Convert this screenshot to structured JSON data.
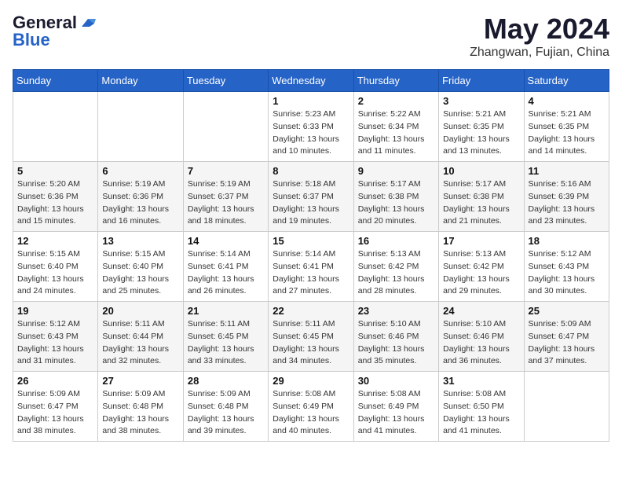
{
  "logo": {
    "general": "General",
    "blue": "Blue",
    "tagline": ""
  },
  "header": {
    "title": "May 2024",
    "location": "Zhangwan, Fujian, China"
  },
  "weekdays": [
    "Sunday",
    "Monday",
    "Tuesday",
    "Wednesday",
    "Thursday",
    "Friday",
    "Saturday"
  ],
  "weeks": [
    [
      {
        "day": "",
        "info": ""
      },
      {
        "day": "",
        "info": ""
      },
      {
        "day": "",
        "info": ""
      },
      {
        "day": "1",
        "info": "Sunrise: 5:23 AM\nSunset: 6:33 PM\nDaylight: 13 hours\nand 10 minutes."
      },
      {
        "day": "2",
        "info": "Sunrise: 5:22 AM\nSunset: 6:34 PM\nDaylight: 13 hours\nand 11 minutes."
      },
      {
        "day": "3",
        "info": "Sunrise: 5:21 AM\nSunset: 6:35 PM\nDaylight: 13 hours\nand 13 minutes."
      },
      {
        "day": "4",
        "info": "Sunrise: 5:21 AM\nSunset: 6:35 PM\nDaylight: 13 hours\nand 14 minutes."
      }
    ],
    [
      {
        "day": "5",
        "info": "Sunrise: 5:20 AM\nSunset: 6:36 PM\nDaylight: 13 hours\nand 15 minutes."
      },
      {
        "day": "6",
        "info": "Sunrise: 5:19 AM\nSunset: 6:36 PM\nDaylight: 13 hours\nand 16 minutes."
      },
      {
        "day": "7",
        "info": "Sunrise: 5:19 AM\nSunset: 6:37 PM\nDaylight: 13 hours\nand 18 minutes."
      },
      {
        "day": "8",
        "info": "Sunrise: 5:18 AM\nSunset: 6:37 PM\nDaylight: 13 hours\nand 19 minutes."
      },
      {
        "day": "9",
        "info": "Sunrise: 5:17 AM\nSunset: 6:38 PM\nDaylight: 13 hours\nand 20 minutes."
      },
      {
        "day": "10",
        "info": "Sunrise: 5:17 AM\nSunset: 6:38 PM\nDaylight: 13 hours\nand 21 minutes."
      },
      {
        "day": "11",
        "info": "Sunrise: 5:16 AM\nSunset: 6:39 PM\nDaylight: 13 hours\nand 23 minutes."
      }
    ],
    [
      {
        "day": "12",
        "info": "Sunrise: 5:15 AM\nSunset: 6:40 PM\nDaylight: 13 hours\nand 24 minutes."
      },
      {
        "day": "13",
        "info": "Sunrise: 5:15 AM\nSunset: 6:40 PM\nDaylight: 13 hours\nand 25 minutes."
      },
      {
        "day": "14",
        "info": "Sunrise: 5:14 AM\nSunset: 6:41 PM\nDaylight: 13 hours\nand 26 minutes."
      },
      {
        "day": "15",
        "info": "Sunrise: 5:14 AM\nSunset: 6:41 PM\nDaylight: 13 hours\nand 27 minutes."
      },
      {
        "day": "16",
        "info": "Sunrise: 5:13 AM\nSunset: 6:42 PM\nDaylight: 13 hours\nand 28 minutes."
      },
      {
        "day": "17",
        "info": "Sunrise: 5:13 AM\nSunset: 6:42 PM\nDaylight: 13 hours\nand 29 minutes."
      },
      {
        "day": "18",
        "info": "Sunrise: 5:12 AM\nSunset: 6:43 PM\nDaylight: 13 hours\nand 30 minutes."
      }
    ],
    [
      {
        "day": "19",
        "info": "Sunrise: 5:12 AM\nSunset: 6:43 PM\nDaylight: 13 hours\nand 31 minutes."
      },
      {
        "day": "20",
        "info": "Sunrise: 5:11 AM\nSunset: 6:44 PM\nDaylight: 13 hours\nand 32 minutes."
      },
      {
        "day": "21",
        "info": "Sunrise: 5:11 AM\nSunset: 6:45 PM\nDaylight: 13 hours\nand 33 minutes."
      },
      {
        "day": "22",
        "info": "Sunrise: 5:11 AM\nSunset: 6:45 PM\nDaylight: 13 hours\nand 34 minutes."
      },
      {
        "day": "23",
        "info": "Sunrise: 5:10 AM\nSunset: 6:46 PM\nDaylight: 13 hours\nand 35 minutes."
      },
      {
        "day": "24",
        "info": "Sunrise: 5:10 AM\nSunset: 6:46 PM\nDaylight: 13 hours\nand 36 minutes."
      },
      {
        "day": "25",
        "info": "Sunrise: 5:09 AM\nSunset: 6:47 PM\nDaylight: 13 hours\nand 37 minutes."
      }
    ],
    [
      {
        "day": "26",
        "info": "Sunrise: 5:09 AM\nSunset: 6:47 PM\nDaylight: 13 hours\nand 38 minutes."
      },
      {
        "day": "27",
        "info": "Sunrise: 5:09 AM\nSunset: 6:48 PM\nDaylight: 13 hours\nand 38 minutes."
      },
      {
        "day": "28",
        "info": "Sunrise: 5:09 AM\nSunset: 6:48 PM\nDaylight: 13 hours\nand 39 minutes."
      },
      {
        "day": "29",
        "info": "Sunrise: 5:08 AM\nSunset: 6:49 PM\nDaylight: 13 hours\nand 40 minutes."
      },
      {
        "day": "30",
        "info": "Sunrise: 5:08 AM\nSunset: 6:49 PM\nDaylight: 13 hours\nand 41 minutes."
      },
      {
        "day": "31",
        "info": "Sunrise: 5:08 AM\nSunset: 6:50 PM\nDaylight: 13 hours\nand 41 minutes."
      },
      {
        "day": "",
        "info": ""
      }
    ]
  ]
}
